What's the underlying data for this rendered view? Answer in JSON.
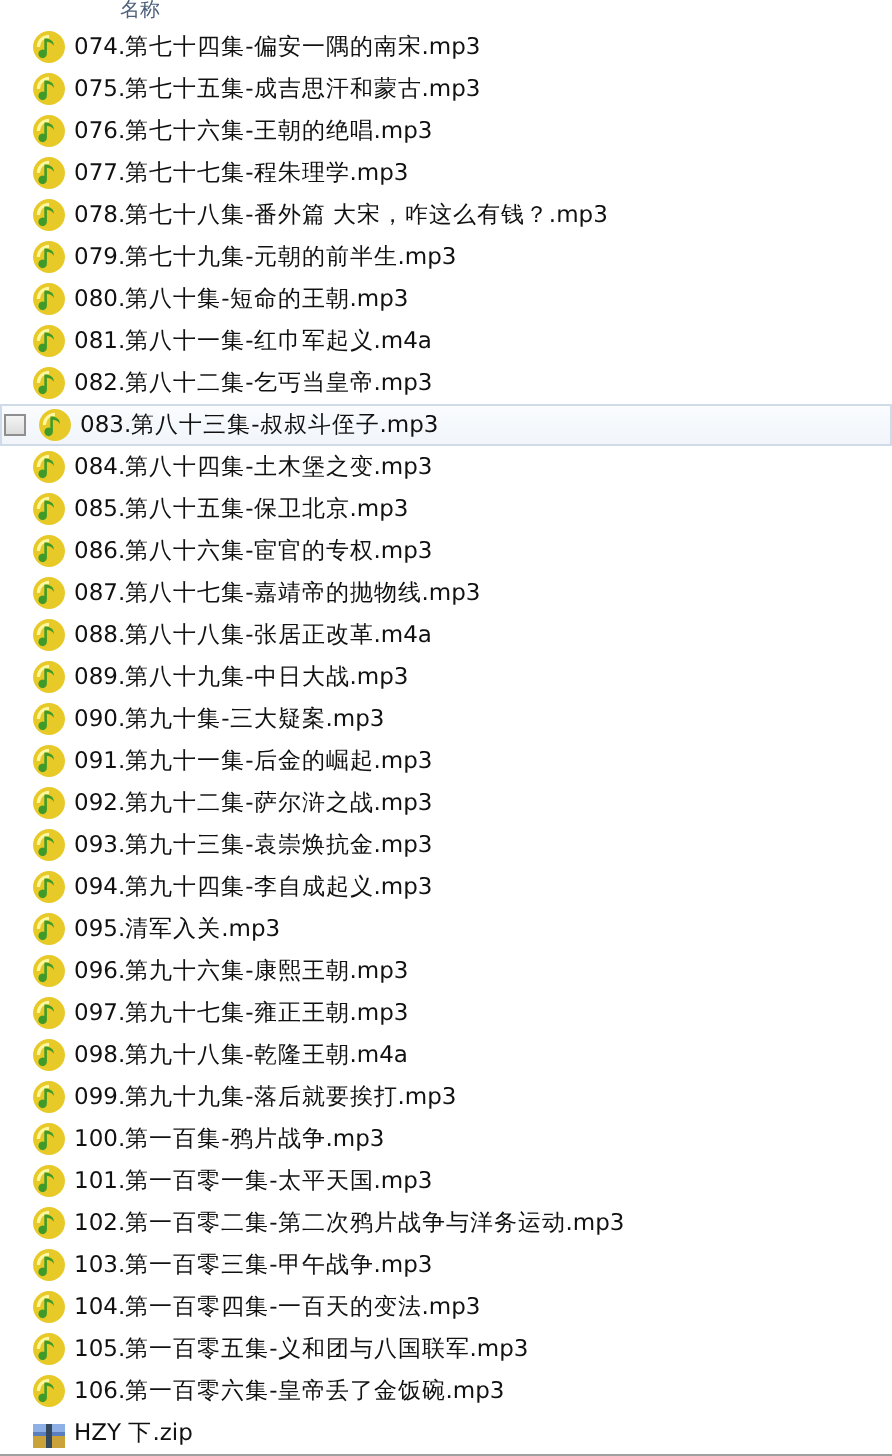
{
  "header": {
    "column_label": "名称"
  },
  "files": [
    {
      "name": "074.第七十四集-偏安一隅的南宋.mp3",
      "kind": "audio",
      "selected": false
    },
    {
      "name": "075.第七十五集-成吉思汗和蒙古.mp3",
      "kind": "audio",
      "selected": false
    },
    {
      "name": "076.第七十六集-王朝的绝唱.mp3",
      "kind": "audio",
      "selected": false
    },
    {
      "name": "077.第七十七集-程朱理学.mp3",
      "kind": "audio",
      "selected": false
    },
    {
      "name": "078.第七十八集-番外篇 大宋，咋这么有钱？.mp3",
      "kind": "audio",
      "selected": false
    },
    {
      "name": "079.第七十九集-元朝的前半生.mp3",
      "kind": "audio",
      "selected": false
    },
    {
      "name": "080.第八十集-短命的王朝.mp3",
      "kind": "audio",
      "selected": false
    },
    {
      "name": "081.第八十一集-红巾军起义.m4a",
      "kind": "audio",
      "selected": false
    },
    {
      "name": "082.第八十二集-乞丐当皇帝.mp3",
      "kind": "audio",
      "selected": false
    },
    {
      "name": "083.第八十三集-叔叔斗侄子.mp3",
      "kind": "audio",
      "selected": true
    },
    {
      "name": "084.第八十四集-土木堡之变.mp3",
      "kind": "audio",
      "selected": false
    },
    {
      "name": "085.第八十五集-保卫北京.mp3",
      "kind": "audio",
      "selected": false
    },
    {
      "name": "086.第八十六集-宦官的专权.mp3",
      "kind": "audio",
      "selected": false
    },
    {
      "name": "087.第八十七集-嘉靖帝的抛物线.mp3",
      "kind": "audio",
      "selected": false
    },
    {
      "name": "088.第八十八集-张居正改革.m4a",
      "kind": "audio",
      "selected": false
    },
    {
      "name": "089.第八十九集-中日大战.mp3",
      "kind": "audio",
      "selected": false
    },
    {
      "name": "090.第九十集-三大疑案.mp3",
      "kind": "audio",
      "selected": false
    },
    {
      "name": "091.第九十一集-后金的崛起.mp3",
      "kind": "audio",
      "selected": false
    },
    {
      "name": "092.第九十二集-萨尔浒之战.mp3",
      "kind": "audio",
      "selected": false
    },
    {
      "name": "093.第九十三集-袁崇焕抗金.mp3",
      "kind": "audio",
      "selected": false
    },
    {
      "name": "094.第九十四集-李自成起义.mp3",
      "kind": "audio",
      "selected": false
    },
    {
      "name": "095.清军入关.mp3",
      "kind": "audio",
      "selected": false
    },
    {
      "name": "096.第九十六集-康熙王朝.mp3",
      "kind": "audio",
      "selected": false
    },
    {
      "name": "097.第九十七集-雍正王朝.mp3",
      "kind": "audio",
      "selected": false
    },
    {
      "name": "098.第九十八集-乾隆王朝.m4a",
      "kind": "audio",
      "selected": false
    },
    {
      "name": "099.第九十九集-落后就要挨打.mp3",
      "kind": "audio",
      "selected": false
    },
    {
      "name": "100.第一百集-鸦片战争.mp3",
      "kind": "audio",
      "selected": false
    },
    {
      "name": "101.第一百零一集-太平天国.mp3",
      "kind": "audio",
      "selected": false
    },
    {
      "name": "102.第一百零二集-第二次鸦片战争与洋务运动.mp3",
      "kind": "audio",
      "selected": false
    },
    {
      "name": "103.第一百零三集-甲午战争.mp3",
      "kind": "audio",
      "selected": false
    },
    {
      "name": "104.第一百零四集-一百天的变法.mp3",
      "kind": "audio",
      "selected": false
    },
    {
      "name": "105.第一百零五集-义和团与八国联军.mp3",
      "kind": "audio",
      "selected": false
    },
    {
      "name": "106.第一百零六集-皇帝丢了金饭碗.mp3",
      "kind": "audio",
      "selected": false
    },
    {
      "name": "HZY 下.zip",
      "kind": "archive",
      "selected": false
    }
  ]
}
